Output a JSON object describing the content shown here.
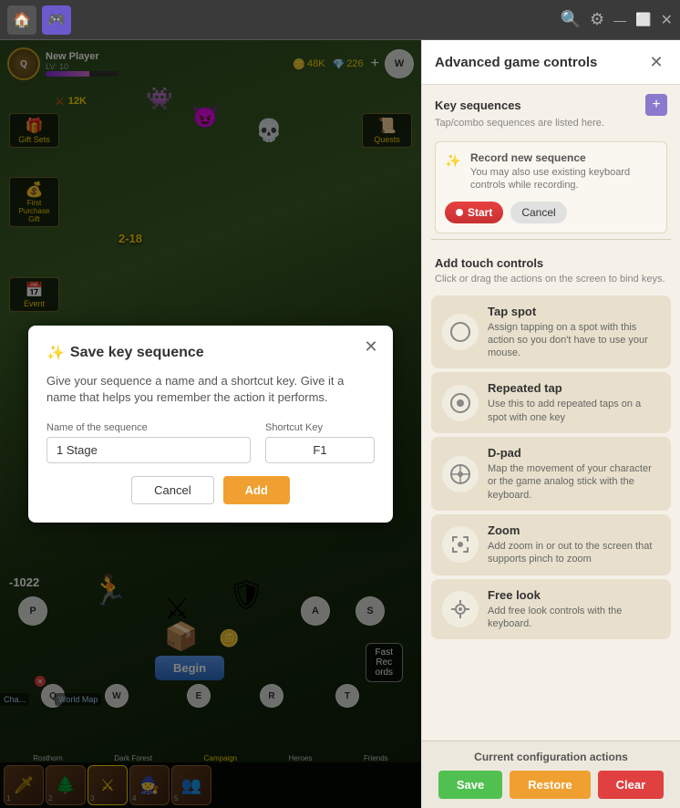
{
  "topbar": {
    "icons": [
      "🏠",
      "🎮"
    ],
    "controls": [
      "🔍",
      "⚙",
      "—",
      "⬜",
      "✕"
    ]
  },
  "game": {
    "player": {
      "name": "New Player",
      "level": "LV: 10",
      "currency1": "48K",
      "currency2": "226",
      "power": "12K"
    },
    "keys": {
      "q": "Q",
      "w": "W",
      "p": "P",
      "a": "A",
      "s": "S",
      "e": "E",
      "r": "R",
      "t": "T"
    },
    "sideItems": [
      "Gift Sets",
      "First Purchase\nGift",
      "Event",
      "Quests"
    ],
    "bottomSkills": [
      "1",
      "2",
      "3",
      "4",
      "5"
    ],
    "bottomLabels": [
      "Rosthorn",
      "Dark Forest",
      "Campaign",
      "Heroes",
      "Friends"
    ]
  },
  "modal": {
    "title": "Save key sequence",
    "titleIcon": "✨",
    "description": "Give your sequence a name and a shortcut key. Give it a name that helps you remember the action it performs.",
    "nameLabel": "Name of the sequence",
    "nameValue": "1 Stage",
    "shortcutLabel": "Shortcut Key",
    "shortcutValue": "F1",
    "cancelLabel": "Cancel",
    "addLabel": "Add"
  },
  "panel": {
    "title": "Advanced game controls",
    "closeIcon": "✕",
    "keySequences": {
      "sectionTitle": "Key sequences",
      "subtitle": "Tap/combo sequences are listed here.",
      "plusIcon": "+",
      "record": {
        "title": "Record new sequence",
        "icon": "✨",
        "desc": "You may also use existing keyboard controls while recording.",
        "startLabel": "Start",
        "cancelLabel": "Cancel"
      }
    },
    "touchControls": {
      "sectionTitle": "Add touch controls",
      "subtitle": "Click or drag the actions on the screen to bind keys.",
      "items": [
        {
          "title": "Tap spot",
          "icon": "○",
          "desc": "Assign tapping on a spot with this action so you don't have to use your mouse."
        },
        {
          "title": "Repeated tap",
          "icon": "○",
          "desc": "Use this to add repeated taps on a spot with one key"
        },
        {
          "title": "D-pad",
          "icon": "⊕",
          "desc": "Map the movement of your character or the game analog stick with the keyboard."
        },
        {
          "title": "Zoom",
          "icon": "✋",
          "desc": "Add zoom in or out to the screen that supports pinch to zoom"
        },
        {
          "title": "Free look",
          "icon": "👁",
          "desc": "Add free look controls with the keyboard."
        }
      ]
    },
    "configBar": {
      "title": "Current configuration actions",
      "saveLabel": "Save",
      "restoreLabel": "Restore",
      "clearLabel": "Clear"
    }
  }
}
